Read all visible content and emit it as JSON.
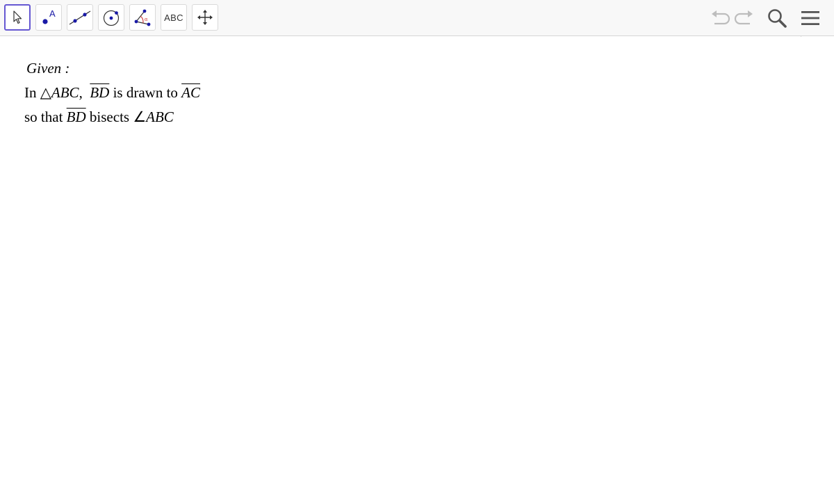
{
  "toolbar": {
    "tools": [
      {
        "name": "move-tool",
        "icon": "cursor-arrow-icon",
        "selected": true
      },
      {
        "name": "point-tool",
        "icon": "point-icon",
        "label": "A"
      },
      {
        "name": "line-tool",
        "icon": "line-through-points-icon"
      },
      {
        "name": "circle-tool",
        "icon": "circle-center-point-icon"
      },
      {
        "name": "angle-tool",
        "icon": "angle-icon",
        "label": "α"
      },
      {
        "name": "text-tool",
        "icon": "text-icon",
        "label": "ABC"
      },
      {
        "name": "move-view-tool",
        "icon": "move-arrows-icon"
      }
    ],
    "right": [
      "undo-icon",
      "redo-icon",
      "search-icon",
      "menu-icon"
    ],
    "accent": "#6557d2",
    "point_color": "#1a1aa6"
  },
  "algebra_toggle_icon": "algebra-view-icon",
  "content": {
    "given_label": "Given :",
    "line1": {
      "t1": "In △",
      "t2": "ABC",
      "t3": ",",
      "t4": "BD",
      "t5": "is drawn to",
      "t6": "AC"
    },
    "line2": {
      "t1": "so that",
      "t2": "BD",
      "t3": "bisects ∠",
      "t4": "ABC"
    }
  }
}
